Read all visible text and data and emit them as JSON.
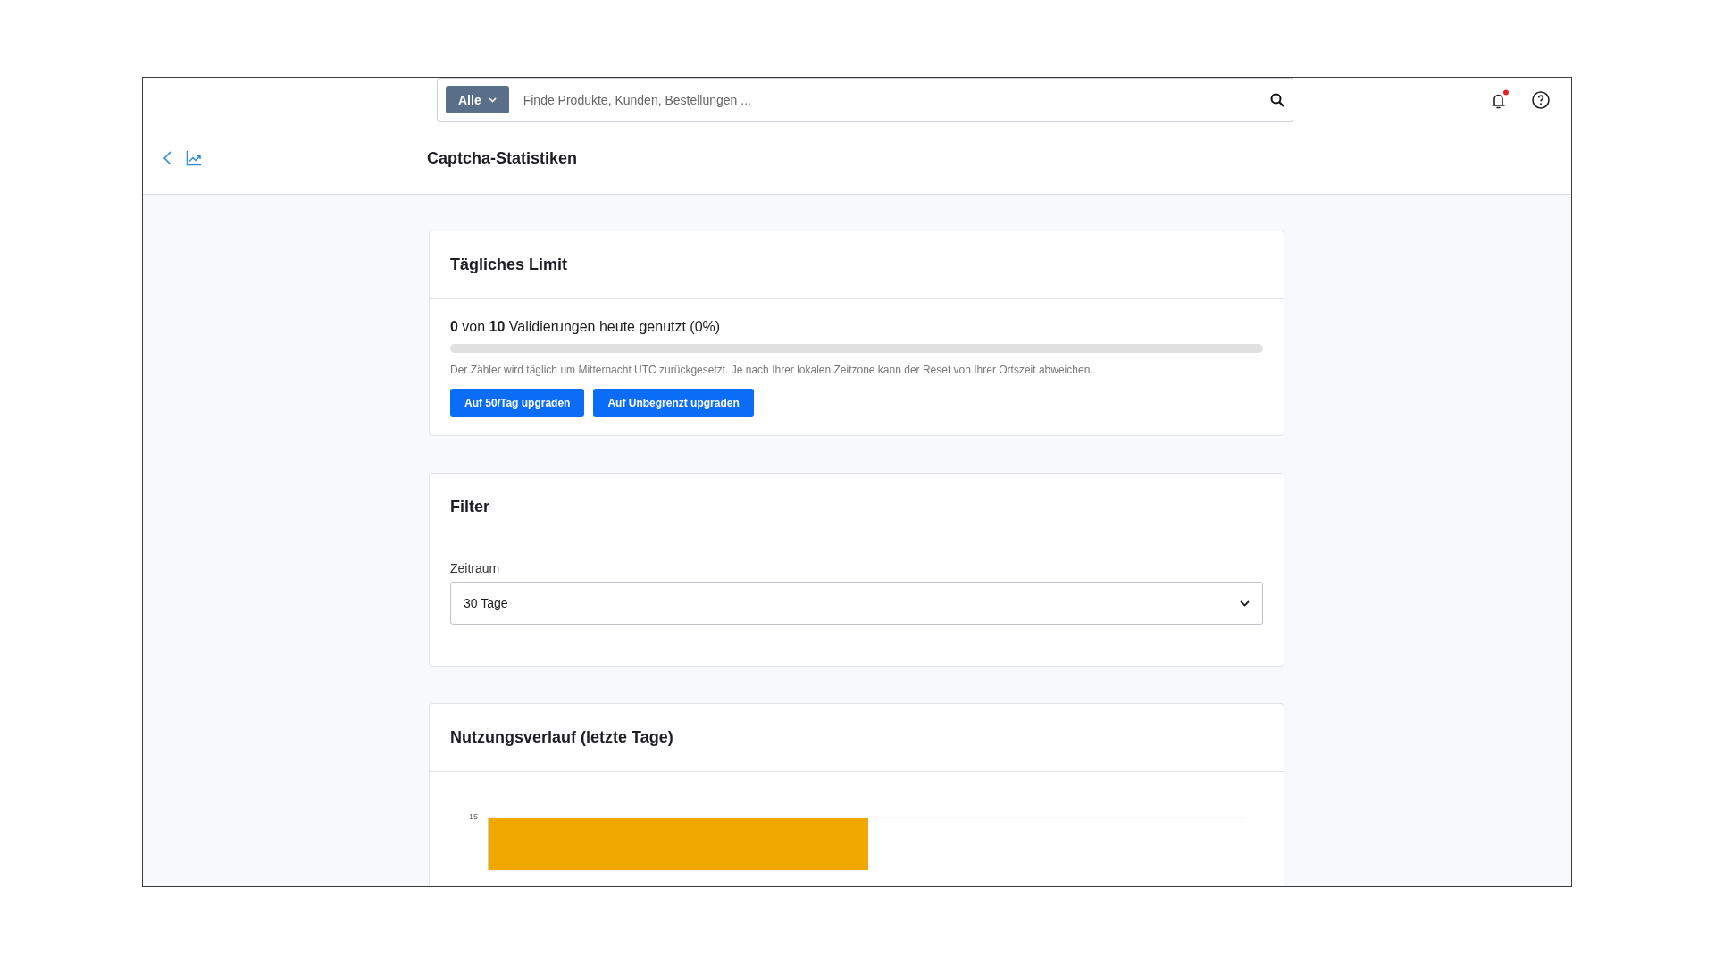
{
  "search": {
    "scope": "Alle",
    "placeholder": "Finde Produkte, Kunden, Bestellungen ..."
  },
  "notifications": {
    "unread": true
  },
  "page": {
    "title": "Captcha-Statistiken"
  },
  "daily_limit": {
    "title": "Tägliches Limit",
    "usage": "**0** von **10** Validierungen heute genutzt (0%)",
    "level": 0,
    "note": "Der Zähler wird täglich um Mitternacht UTC zurückgesetzt. Je nach Ihrer lokalen Zeitzone kann der Reset von Ihrer Ortszeit abweichen.",
    "buttons": [
      "Auf 50/Tag upgraden",
      "Auf Unbegrenzt upgraden"
    ]
  },
  "filter": {
    "title": "Filter",
    "field_label": "Zeitraum",
    "value": "30 Tage"
  },
  "usage_history": {
    "title": "Nutzungsverlauf (letzte Tage)",
    "y_tick": "15"
  }
}
